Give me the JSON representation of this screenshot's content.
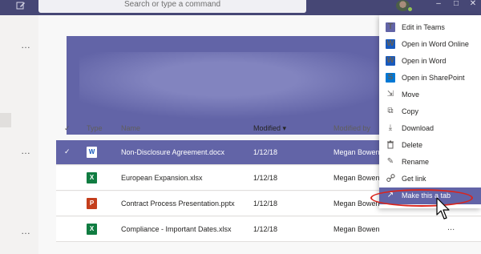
{
  "topbar": {
    "search_placeholder": "Search or type a command",
    "compose_icon": "compose-icon",
    "window_controls": [
      "–",
      "□",
      "✕"
    ]
  },
  "left_panel": {
    "more_glyph": "…"
  },
  "table": {
    "headers": {
      "type": "Type",
      "name": "Name",
      "modified": "Modified",
      "modified_sort": "▾",
      "modified_by": "Modified by"
    },
    "rows": [
      {
        "icon": "W",
        "icon_color": "#185abd",
        "name": "Non-Disclosure Agreement.docx",
        "modified": "1/12/18",
        "modified_by": "Megan Bowen",
        "selected": true
      },
      {
        "icon": "X",
        "icon_color": "#107c41",
        "name": "European Expansion.xlsx",
        "modified": "1/12/18",
        "modified_by": "Megan Bowen",
        "selected": false
      },
      {
        "icon": "P",
        "icon_color": "#c43e1c",
        "name": "Contract Process Presentation.pptx",
        "modified": "1/12/18",
        "modified_by": "Megan Bowen",
        "selected": false
      },
      {
        "icon": "X",
        "icon_color": "#107c41",
        "name": "Compliance - Important Dates.xlsx",
        "modified": "1/12/18",
        "modified_by": "Megan Bowen",
        "selected": false
      }
    ],
    "row_more": "..."
  },
  "menu": {
    "items": [
      {
        "label": "Edit in Teams",
        "icon": "teams-icon",
        "glyph": "T",
        "color": "#6264a7",
        "highlighted": false
      },
      {
        "label": "Open in Word Online",
        "icon": "word-icon",
        "glyph": "W",
        "color": "#185abd",
        "highlighted": false
      },
      {
        "label": "Open in Word",
        "icon": "word-icon",
        "glyph": "W",
        "color": "#185abd",
        "highlighted": false
      },
      {
        "label": "Open in SharePoint",
        "icon": "sharepoint-icon",
        "glyph": "S",
        "color": "#0078d4",
        "highlighted": false
      },
      {
        "label": "Move",
        "icon": "move-icon",
        "glyph": "⇲",
        "color": "",
        "highlighted": false
      },
      {
        "label": "Copy",
        "icon": "copy-icon",
        "glyph": "⧉",
        "color": "",
        "highlighted": false
      },
      {
        "label": "Download",
        "icon": "download-icon",
        "glyph": "⤓",
        "color": "",
        "highlighted": false
      },
      {
        "label": "Delete",
        "icon": "trash-icon",
        "glyph": "🗑",
        "color": "",
        "highlighted": false
      },
      {
        "label": "Rename",
        "icon": "rename-icon",
        "glyph": "✎",
        "color": "",
        "highlighted": false
      },
      {
        "label": "Get link",
        "icon": "link-icon",
        "glyph": "🔗",
        "color": "",
        "highlighted": false
      },
      {
        "label": "Make this a tab",
        "icon": "external-tab-icon",
        "glyph": "↗",
        "color": "",
        "highlighted": true
      }
    ]
  },
  "colors": {
    "accent": "#6264a7",
    "topbar": "#464775",
    "annotation_oval": "#d9251d"
  }
}
